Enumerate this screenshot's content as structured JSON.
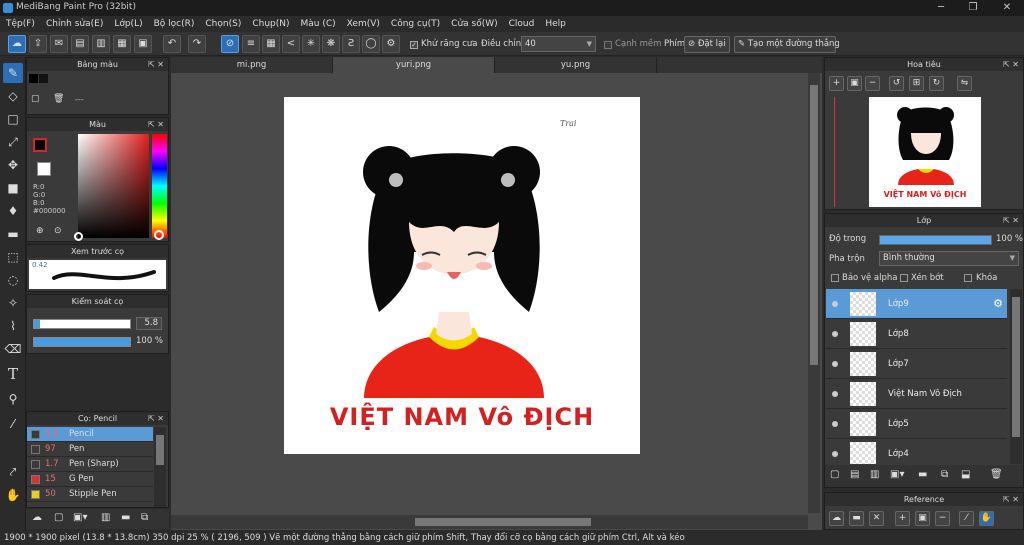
{
  "window": {
    "title": "MediBang Paint Pro (32bit)",
    "controls": [
      "─",
      "❐",
      "✕"
    ]
  },
  "menu": [
    "Tệp(F)",
    "Chỉnh sửa(E)",
    "Lớp(L)",
    "Bộ lọc(R)",
    "Chọn(S)",
    "Chụp(N)",
    "Màu (C)",
    "Xem(V)",
    "Công cụ(T)",
    "Cửa số(W)",
    "Cloud",
    "Help"
  ],
  "toolbar": {
    "antialias_label": "Khử răng cưa",
    "adjust_label": "Điều chỉnh",
    "adjust_value": "40",
    "soft_edge_label": "Cạnh mềm",
    "key_label": "Phím",
    "reset_label": "Đặt lại",
    "line_label": "Tạo một đường thẳng"
  },
  "palette_panel": {
    "title": "Bảng màu",
    "placeholder": "---"
  },
  "color_panel": {
    "title": "Màu",
    "r": "R:0",
    "g": "G:0",
    "b": "B:0",
    "hex": "#000000",
    "current_color": "#000000"
  },
  "preview_panel": {
    "title": "Xem trước cọ",
    "size_text": "0.42"
  },
  "brush_control": {
    "title": "Kiểm soát cọ",
    "size_value": "5.8",
    "opacity_value": "100 %"
  },
  "brush_panel": {
    "title": "Cọ: Pencil",
    "items": [
      {
        "size": "5.8",
        "name": "Pencil",
        "color": "#3a3a3a",
        "selected": true
      },
      {
        "size": "97",
        "name": "Pen",
        "color": "#3a3a3a",
        "selected": false
      },
      {
        "size": "1.7",
        "name": "Pen (Sharp)",
        "color": "#3a3a3a",
        "selected": false
      },
      {
        "size": "15",
        "name": "G Pen",
        "color": "#e03030",
        "selected": false
      },
      {
        "size": "50",
        "name": "Stipple Pen",
        "color": "#e8d020",
        "selected": false
      }
    ]
  },
  "tabs": [
    "mi.png",
    "yuri.png",
    "yu.png"
  ],
  "artwork": {
    "headline": "VIỆT NAM Vô ĐỊCH",
    "signature": "Trai",
    "headline_color": "#d42020"
  },
  "navigator_panel": {
    "title": "Hoa tiêu",
    "thumb_headline": "VIỆT NAM Vô ĐỊCH"
  },
  "layer_panel": {
    "title": "Lớp",
    "opacity_label": "Độ trong",
    "opacity_value": "100 %",
    "opacity_level": 1.0,
    "blend_label": "Pha trộn",
    "blend_value": "Bình thường",
    "protect_alpha": "Bảo vệ alpha",
    "clipping": "Xén bớt",
    "lock": "Khóa",
    "layers": [
      {
        "name": "Lớp9",
        "selected": true
      },
      {
        "name": "Lớp8",
        "selected": false
      },
      {
        "name": "Lớp7",
        "selected": false
      },
      {
        "name": "Việt Nam Vô Địch",
        "selected": false
      },
      {
        "name": "Lớp5",
        "selected": false
      },
      {
        "name": "Lớp4",
        "selected": false
      }
    ]
  },
  "reference_panel": {
    "title": "Reference"
  },
  "status": "1900 * 1900 pixel   (13.8 * 13.8cm)   350 dpi   25 %   ( 2196, 509 )   Vẽ một đường thẳng bằng cách giữ phím Shift, Thay đổi cỡ cọ bằng cách giữ phím Ctrl, Alt và kéo"
}
